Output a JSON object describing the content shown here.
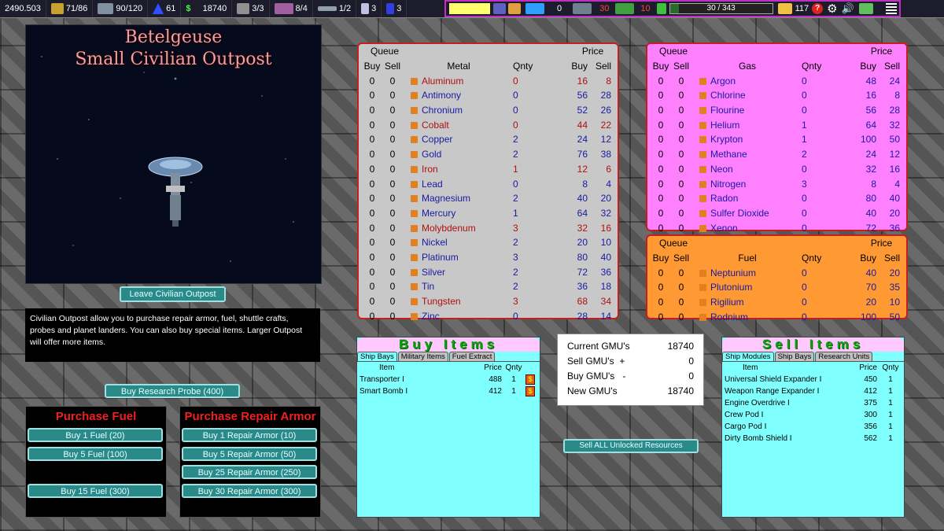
{
  "topbar": {
    "credits": "2490.503",
    "cargo": "71/86",
    "crew": "90/120",
    "fuel": "61",
    "gmu": "18740",
    "shuttles": "3/3",
    "landers": "8/4",
    "probes": "1/2",
    "stat_a": "3",
    "stat_b": "3",
    "enemies_a": "0",
    "enemies_b": "30",
    "enemies_c": "10",
    "progress_text": "30 / 343",
    "progress_fraction": 0.087,
    "population": "117"
  },
  "location": {
    "star": "Betelgeuse",
    "station": "Small Civilian Outpost",
    "leave_label": "Leave Civilian Outpost",
    "description": "Civilian Outpost allow you to purchase repair armor, fuel, shuttle crafts, probes and planet landers. You can also buy special items. Larger Outpost will offer more items.",
    "probe_label": "Buy Research Probe (400)"
  },
  "fuel_panel": {
    "title": "Purchase Fuel",
    "buttons": [
      "Buy 1 Fuel (20)",
      "Buy 5 Fuel (100)",
      "Buy 15 Fuel (300)"
    ]
  },
  "armor_panel": {
    "title": "Purchase Repair Armor",
    "buttons": [
      "Buy 1 Repair Armor (10)",
      "Buy 5 Repair Armor (50)",
      "Buy 25 Repair Armor (250)",
      "Buy 30 Repair Armor (300)"
    ]
  },
  "headers": {
    "queue": "Queue",
    "price": "Price",
    "buy": "Buy",
    "sell": "Sell",
    "qnty": "Qnty",
    "metal": "Metal",
    "gas": "Gas",
    "fuel": "Fuel"
  },
  "metals": [
    {
      "name": "Aluminum",
      "qb": "0",
      "qs": "0",
      "qty": "0",
      "buy": "16",
      "sell": "8",
      "c": "rd"
    },
    {
      "name": "Antimony",
      "qb": "0",
      "qs": "0",
      "qty": "0",
      "buy": "56",
      "sell": "28",
      "c": "blue"
    },
    {
      "name": "Chronium",
      "qb": "0",
      "qs": "0",
      "qty": "0",
      "buy": "52",
      "sell": "26",
      "c": "blue"
    },
    {
      "name": "Cobalt",
      "qb": "0",
      "qs": "0",
      "qty": "0",
      "buy": "44",
      "sell": "22",
      "c": "rd"
    },
    {
      "name": "Copper",
      "qb": "0",
      "qs": "0",
      "qty": "2",
      "buy": "24",
      "sell": "12",
      "c": "blue"
    },
    {
      "name": "Gold",
      "qb": "0",
      "qs": "0",
      "qty": "2",
      "buy": "76",
      "sell": "38",
      "c": "blue"
    },
    {
      "name": "Iron",
      "qb": "0",
      "qs": "0",
      "qty": "1",
      "buy": "12",
      "sell": "6",
      "c": "rd"
    },
    {
      "name": "Lead",
      "qb": "0",
      "qs": "0",
      "qty": "0",
      "buy": "8",
      "sell": "4",
      "c": "blue"
    },
    {
      "name": "Magnesium",
      "qb": "0",
      "qs": "0",
      "qty": "2",
      "buy": "40",
      "sell": "20",
      "c": "blue"
    },
    {
      "name": "Mercury",
      "qb": "0",
      "qs": "0",
      "qty": "1",
      "buy": "64",
      "sell": "32",
      "c": "blue"
    },
    {
      "name": "Molybdenum",
      "qb": "0",
      "qs": "0",
      "qty": "3",
      "buy": "32",
      "sell": "16",
      "c": "rd"
    },
    {
      "name": "Nickel",
      "qb": "0",
      "qs": "0",
      "qty": "2",
      "buy": "20",
      "sell": "10",
      "c": "blue"
    },
    {
      "name": "Platinum",
      "qb": "0",
      "qs": "0",
      "qty": "3",
      "buy": "80",
      "sell": "40",
      "c": "blue"
    },
    {
      "name": "Silver",
      "qb": "0",
      "qs": "0",
      "qty": "2",
      "buy": "72",
      "sell": "36",
      "c": "blue"
    },
    {
      "name": "Tin",
      "qb": "0",
      "qs": "0",
      "qty": "2",
      "buy": "36",
      "sell": "18",
      "c": "blue"
    },
    {
      "name": "Tungsten",
      "qb": "0",
      "qs": "0",
      "qty": "3",
      "buy": "68",
      "sell": "34",
      "c": "rd"
    },
    {
      "name": "Zinc",
      "qb": "0",
      "qs": "0",
      "qty": "0",
      "buy": "28",
      "sell": "14",
      "c": "blue"
    }
  ],
  "gases": [
    {
      "name": "Argon",
      "qb": "0",
      "qs": "0",
      "qty": "0",
      "buy": "48",
      "sell": "24"
    },
    {
      "name": "Chlorine",
      "qb": "0",
      "qs": "0",
      "qty": "0",
      "buy": "16",
      "sell": "8"
    },
    {
      "name": "Flourine",
      "qb": "0",
      "qs": "0",
      "qty": "0",
      "buy": "56",
      "sell": "28"
    },
    {
      "name": "Helium",
      "qb": "0",
      "qs": "0",
      "qty": "1",
      "buy": "64",
      "sell": "32"
    },
    {
      "name": "Krypton",
      "qb": "0",
      "qs": "0",
      "qty": "1",
      "buy": "100",
      "sell": "50"
    },
    {
      "name": "Methane",
      "qb": "0",
      "qs": "0",
      "qty": "2",
      "buy": "24",
      "sell": "12"
    },
    {
      "name": "Neon",
      "qb": "0",
      "qs": "0",
      "qty": "0",
      "buy": "32",
      "sell": "16"
    },
    {
      "name": "Nitrogen",
      "qb": "0",
      "qs": "0",
      "qty": "3",
      "buy": "8",
      "sell": "4"
    },
    {
      "name": "Radon",
      "qb": "0",
      "qs": "0",
      "qty": "0",
      "buy": "80",
      "sell": "40"
    },
    {
      "name": "Sulfer Dioxide",
      "qb": "0",
      "qs": "0",
      "qty": "0",
      "buy": "40",
      "sell": "20"
    },
    {
      "name": "Xenon",
      "qb": "0",
      "qs": "0",
      "qty": "0",
      "buy": "72",
      "sell": "36"
    }
  ],
  "fuels": [
    {
      "name": "Neptunium",
      "qb": "0",
      "qs": "0",
      "qty": "0",
      "buy": "40",
      "sell": "20"
    },
    {
      "name": "Plutonium",
      "qb": "0",
      "qs": "0",
      "qty": "0",
      "buy": "70",
      "sell": "35"
    },
    {
      "name": "Rigilium",
      "qb": "0",
      "qs": "0",
      "qty": "0",
      "buy": "20",
      "sell": "10"
    },
    {
      "name": "Rodnium",
      "qb": "0",
      "qs": "0",
      "qty": "0",
      "buy": "100",
      "sell": "50"
    }
  ],
  "buy_items": {
    "title": "Buy Items",
    "tabs": [
      "Ship Bays",
      "Military Items",
      "Fuel Extract"
    ],
    "cols": {
      "item": "Item",
      "price": "Price",
      "qnty": "Qnty"
    },
    "rows": [
      {
        "item": "Transporter I",
        "price": "488",
        "qty": "1"
      },
      {
        "item": "Smart Bomb I",
        "price": "412",
        "qty": "1"
      }
    ]
  },
  "gmu_box": {
    "current_label": "Current GMU's",
    "current_value": "18740",
    "sell_label": "Sell GMU's",
    "sell_sign": "+",
    "sell_value": "0",
    "buy_label": "Buy GMU's",
    "buy_sign": "-",
    "buy_value": "0",
    "new_label": "New GMU's",
    "new_value": "18740"
  },
  "sell_all_label": "Sell ALL Unlocked Resources",
  "sell_items": {
    "title": "Sell Items",
    "tabs": [
      "Ship Modules",
      "Ship Bays",
      "Research Units"
    ],
    "cols": {
      "item": "Item",
      "price": "Price",
      "qnty": "Qnty"
    },
    "rows": [
      {
        "item": "Universal Shield Expander I",
        "price": "450",
        "qty": "1"
      },
      {
        "item": "Weapon Range Expander I",
        "price": "412",
        "qty": "1"
      },
      {
        "item": "Engine Overdrive I",
        "price": "375",
        "qty": "1"
      },
      {
        "item": "Crew Pod I",
        "price": "300",
        "qty": "1"
      },
      {
        "item": "Cargo Pod I",
        "price": "356",
        "qty": "1"
      },
      {
        "item": "Dirty Bomb Shield I",
        "price": "562",
        "qty": "1"
      }
    ]
  },
  "colors": {
    "metal_bg": "#c8c8c8",
    "gas_bg": "#ff80ff",
    "fuel_bg": "#ff9933",
    "panel_border": "#c02020"
  }
}
